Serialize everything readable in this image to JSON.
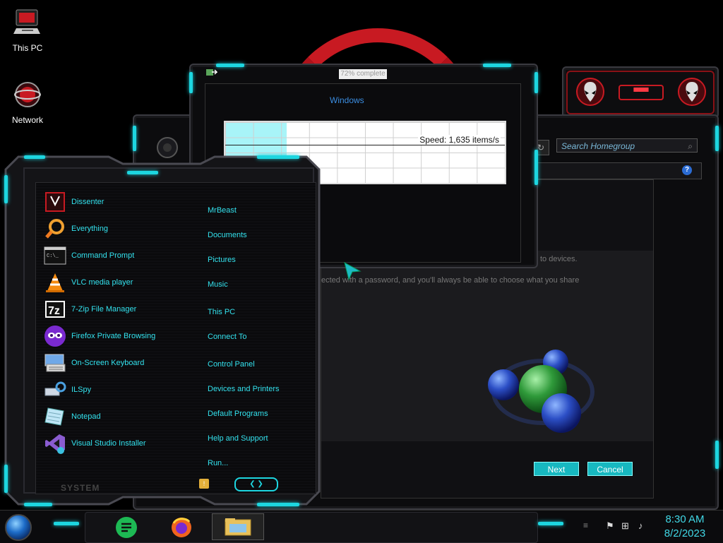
{
  "desktop": {
    "icons": [
      {
        "label": "This PC",
        "icon": "this-pc-icon"
      },
      {
        "label": "Network",
        "icon": "network-icon"
      }
    ]
  },
  "copy_dialog": {
    "title": "72% complete",
    "subtitle": "Windows",
    "speed": "Speed: 1,635 items/s",
    "progress": 0.22
  },
  "homegroup": {
    "search_placeholder": "Search Homegroup",
    "text_devices": "to devices.",
    "text_password": "ected with a password, and you'll always be able to choose what you share",
    "next_label": "Next",
    "cancel_label": "Cancel"
  },
  "start_menu": {
    "programs": [
      {
        "label": "Dissenter",
        "icon": "dissenter-icon"
      },
      {
        "label": "Everything",
        "icon": "search-icon"
      },
      {
        "label": "Command Prompt",
        "icon": "command-prompt-icon"
      },
      {
        "label": "VLC media player",
        "icon": "vlc-cone-icon"
      },
      {
        "label": "7-Zip File Manager",
        "icon": "7zip-icon"
      },
      {
        "label": "Firefox Private Browsing",
        "icon": "private-mask-icon"
      },
      {
        "label": "On-Screen Keyboard",
        "icon": "keyboard-icon"
      },
      {
        "label": "ILSpy",
        "icon": "ilspy-icon"
      },
      {
        "label": "Notepad",
        "icon": "notepad-icon"
      },
      {
        "label": "Visual Studio Installer",
        "icon": "visual-studio-icon"
      }
    ],
    "places": [
      "MrBeast",
      "Documents",
      "Pictures",
      "Music",
      "This PC",
      "Connect To",
      "Control Panel",
      "Devices and Printers",
      "Default Programs",
      "Help and Support",
      "Run..."
    ],
    "system_label": "SYSTEM"
  },
  "taskbar": {
    "apps": [
      {
        "name": "Start",
        "icon": "start-orb-icon"
      },
      {
        "name": "Notes",
        "icon": "notes-icon"
      },
      {
        "name": "Firefox",
        "icon": "firefox-icon"
      },
      {
        "name": "File Explorer",
        "icon": "file-explorer-icon"
      }
    ],
    "time": "8:30 AM",
    "date": "8/2/2023"
  },
  "colors": {
    "accent": "#1dd6e0",
    "alien_red": "#c81a22"
  }
}
